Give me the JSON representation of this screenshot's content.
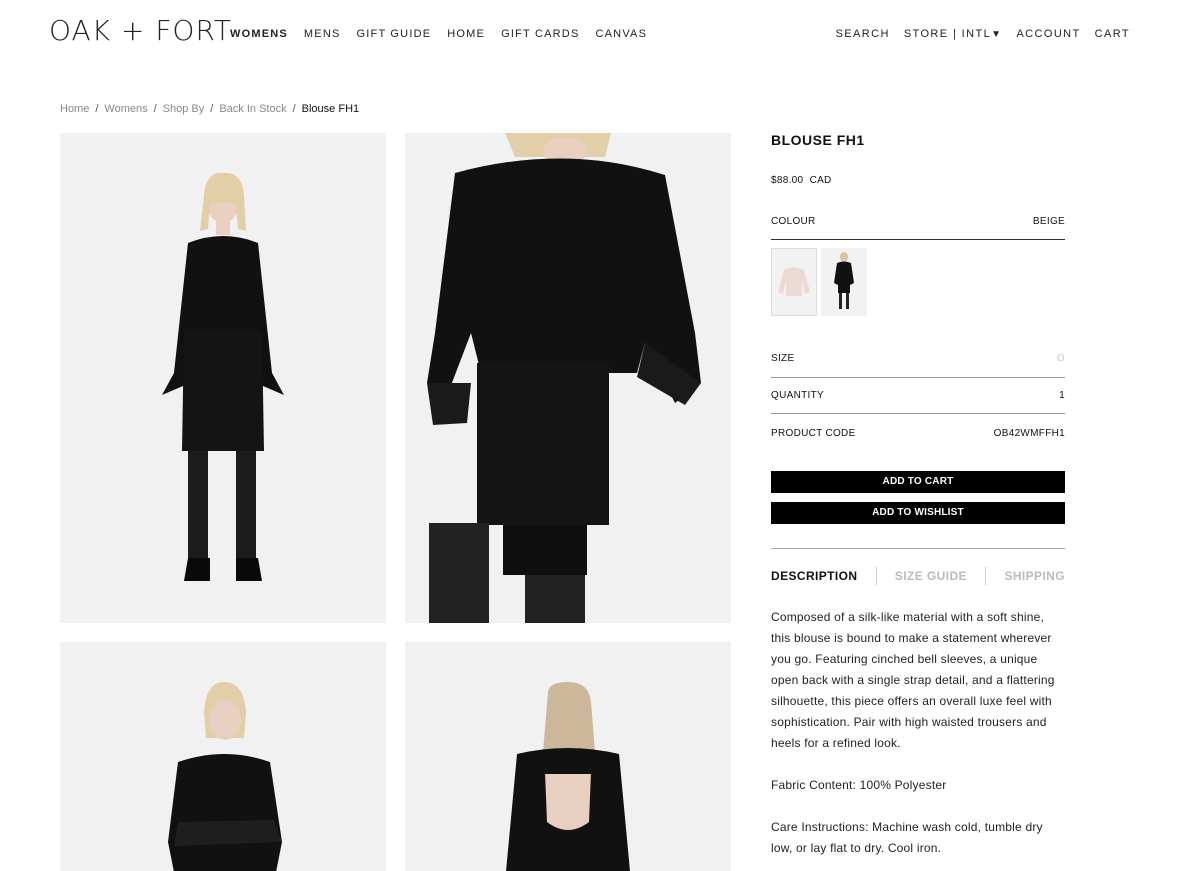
{
  "header": {
    "logo": "OAK + FORT",
    "nav": [
      "WOMENS",
      "MENS",
      "GIFT GUIDE",
      "HOME",
      "GIFT CARDS",
      "CANVAS"
    ],
    "search": "SEARCH",
    "store": "STORE | INTL",
    "account": "ACCOUNT",
    "cart": "CART"
  },
  "breadcrumb": [
    "Home",
    "Womens",
    "Shop By",
    "Back In Stock"
  ],
  "breadcrumb_current": "Blouse FH1",
  "product": {
    "title": "BLOUSE FH1",
    "price": "$88.00",
    "currency": "CAD",
    "colour_label": "COLOUR",
    "colour_value": "BEIGE",
    "size_label": "SIZE",
    "size_value": "O",
    "quantity_label": "QUANTITY",
    "quantity_value": "1",
    "code_label": "PRODUCT CODE",
    "code_value": "OB42WMFFH1",
    "add_to_cart": "ADD TO CART",
    "add_to_wishlist": "ADD TO WISHLIST"
  },
  "tabs": [
    "DESCRIPTION",
    "SIZE GUIDE",
    "SHIPPING"
  ],
  "description": {
    "p1": "Composed of a silk-like material with a soft shine, this blouse is bound to make a statement wherever you go. Featuring cinched bell sleeves, a unique open back with a single strap detail, and a flattering silhouette, this piece offers an overall luxe feel with sophistication. Pair with high waisted trousers and heels for a refined look.",
    "p2": "Fabric Content: 100% Polyester",
    "p3": "Care Instructions: Machine wash cold, tumble dry low, or lay flat to dry. Cool iron."
  },
  "colors": {
    "garment": "#111111",
    "photo_bg": "#f1f1f1",
    "swatch_beige": "#ecd9d4"
  }
}
